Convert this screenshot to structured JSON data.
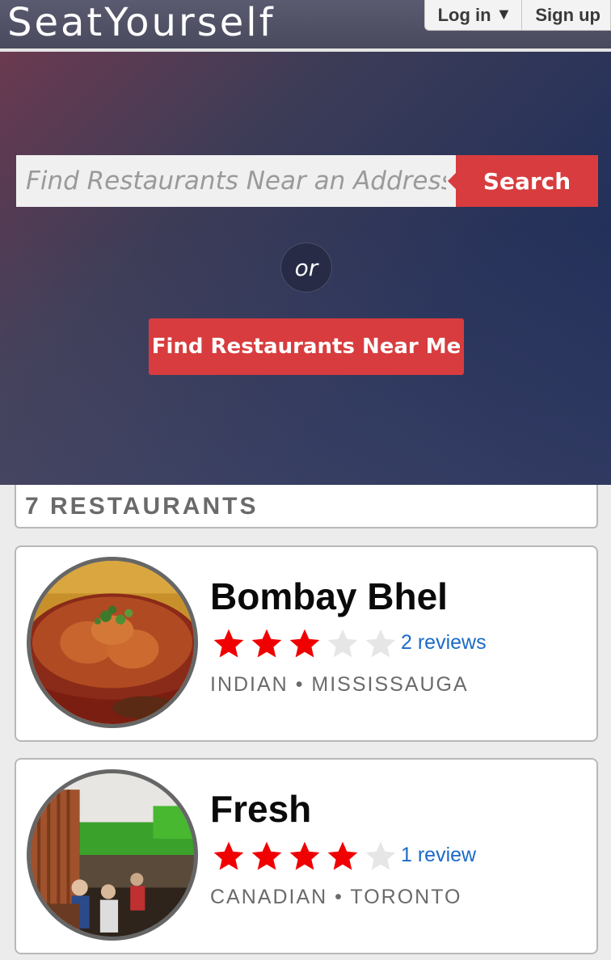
{
  "header": {
    "logo": "SeatYourself",
    "login_label": "Log in",
    "login_caret": "▼",
    "signup_label": "Sign up"
  },
  "hero": {
    "search_placeholder": "Find Restaurants Near an Address",
    "search_button": "Search",
    "or_label": "or",
    "near_me_button": "Find Restaurants Near Me"
  },
  "results": {
    "count_label": "7 RESTAURANTS",
    "restaurants": [
      {
        "name": "Bombay Bhel",
        "rating": 3,
        "max_rating": 5,
        "reviews_label": "2 reviews",
        "cuisine": "INDIAN",
        "separator": "•",
        "city": "MISSISSAUGA"
      },
      {
        "name": "Fresh",
        "rating": 4,
        "max_rating": 5,
        "reviews_label": "1 review",
        "cuisine": "CANADIAN",
        "separator": "•",
        "city": "TORONTO"
      }
    ]
  },
  "colors": {
    "accent": "#d83c3e",
    "star_on": "#f00000",
    "star_off": "#e6e6e6",
    "link": "#1a6bc7"
  }
}
